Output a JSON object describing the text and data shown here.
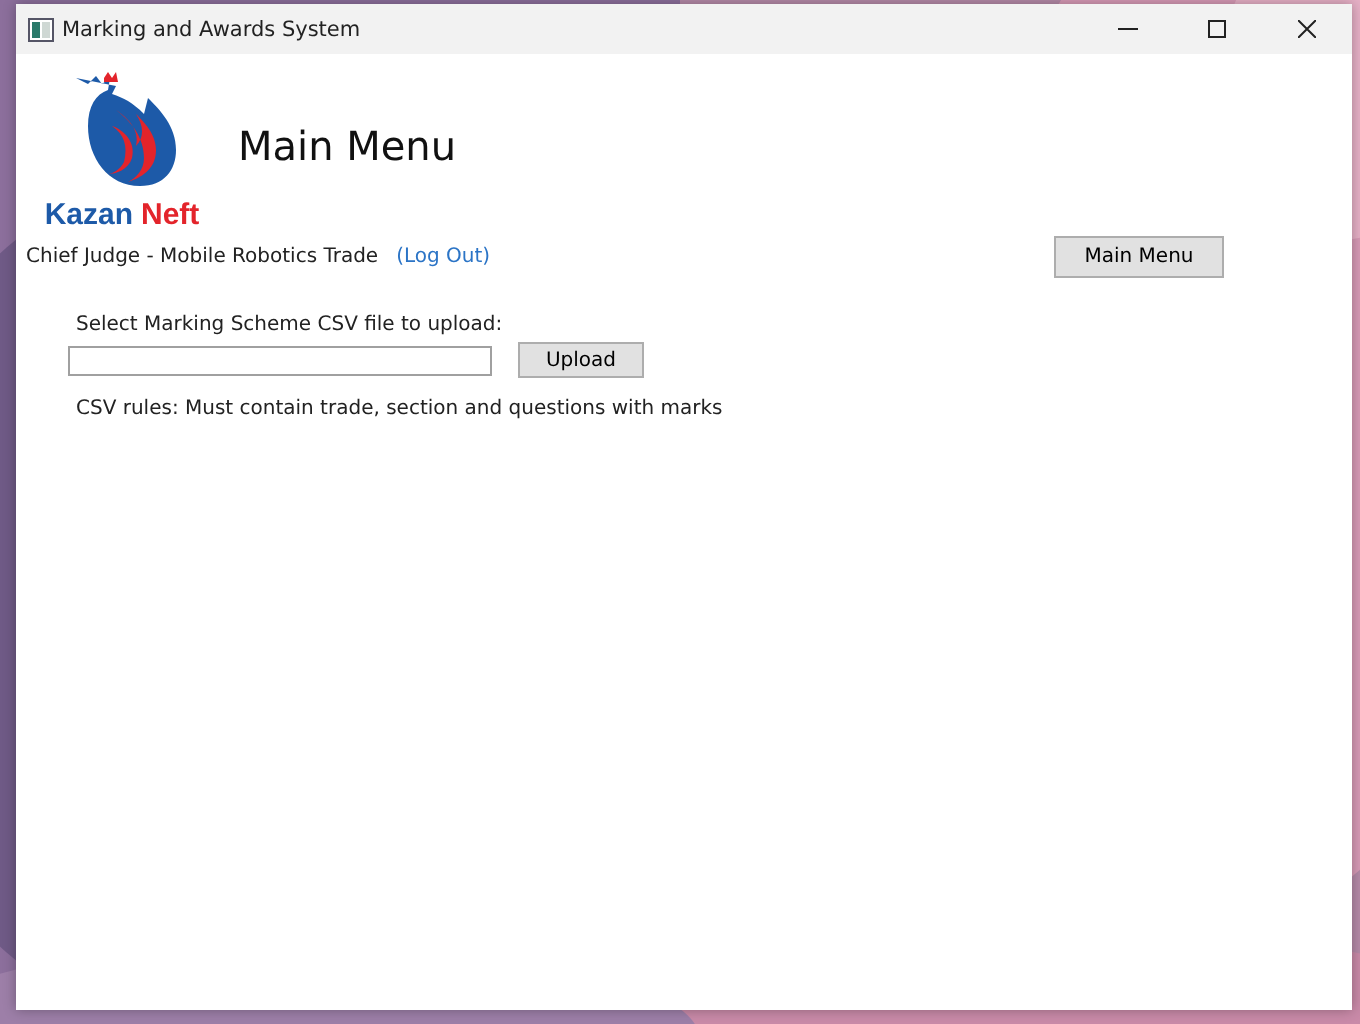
{
  "window": {
    "title": "Marking and Awards System"
  },
  "logo": {
    "word_1": "Kazan",
    "word_2": "Neft"
  },
  "heading": "Main Menu",
  "user": {
    "role": "Chief Judge - Mobile Robotics Trade",
    "logout": "(Log Out)"
  },
  "nav_button": "Main Menu",
  "upload": {
    "label": "Select Marking Scheme CSV file to upload:",
    "button": "Upload",
    "rules": "CSV rules: Must contain trade, section and questions with marks"
  }
}
